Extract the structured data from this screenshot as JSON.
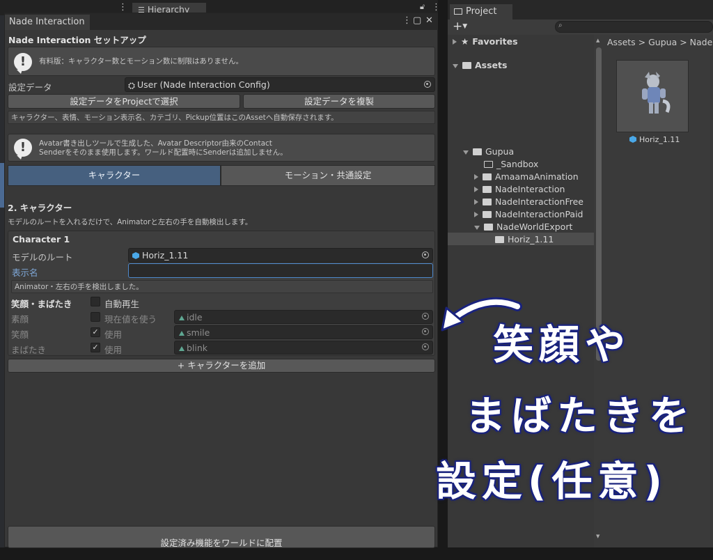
{
  "hierarchy": {
    "tab_label": "Hierarchy"
  },
  "window": {
    "tab_label": "Nade Interaction",
    "title": "Nade Interaction セットアップ",
    "help1": "有料版：キャラクター数とモーション数に制限はありません。",
    "config_label": "設定データ",
    "config_value": "User (Nade Interaction Config)",
    "select_btn": "設定データをProjectで選択",
    "duplicate_btn": "設定データを複製",
    "autosave_info": "キャラクター、表情、モーション表示名、カテゴリ、Pickup位置はこのAssetへ自動保存されます。",
    "help2_line1": "Avatar書き出しツールで生成した、Avatar Descriptor由来のContact",
    "help2_line2": "Senderをそのまま使用します。ワールド配置時にSenderは追加しません。",
    "tab_character": "キャラクター",
    "tab_motion": "モーション・共通設定",
    "section_title": "2. キャラクター",
    "section_desc": "モデルのルートを入れるだけで、Animatorと左右の手を自動検出します。",
    "character": {
      "header": "Character 1",
      "model_root_label": "モデルのルート",
      "model_root_value": "Horiz_1.11",
      "display_name_label": "表示名",
      "display_name_value": "",
      "detect_info": "Animator・左右の手を検出しました。",
      "expr_header": "笑顔・まばたき",
      "autoplay_label": "自動再生",
      "rows": [
        {
          "label": "素顔",
          "check_label": "現在値を使う",
          "checked": false,
          "clip": "idle"
        },
        {
          "label": "笑顔",
          "check_label": "使用",
          "checked": true,
          "clip": "smile"
        },
        {
          "label": "まばたき",
          "check_label": "使用",
          "checked": true,
          "clip": "blink"
        }
      ]
    },
    "add_character_btn": "+ キャラクターを追加",
    "place_btn": "設定済み機能をワールドに配置"
  },
  "project": {
    "tab_label": "Project",
    "add_label": "+",
    "favorites": "Favorites",
    "assets": "Assets",
    "breadcrumb": "Assets  >  Gupua  >  Nade",
    "tree": {
      "gupua": "Gupua",
      "sandbox": "_Sandbox",
      "amaama": "AmaamaAnimation",
      "nade_interaction": "NadeInteraction",
      "nade_free": "NadeInteractionFree",
      "nade_paid": "NadeInteractionPaid",
      "nade_world": "NadeWorldExport",
      "horiz": "Horiz_1.11"
    },
    "asset_name": "Horiz_1.11"
  },
  "annotation": {
    "line1": "笑顔や",
    "line2": "まばたきを",
    "line3": "設定(任意)"
  }
}
